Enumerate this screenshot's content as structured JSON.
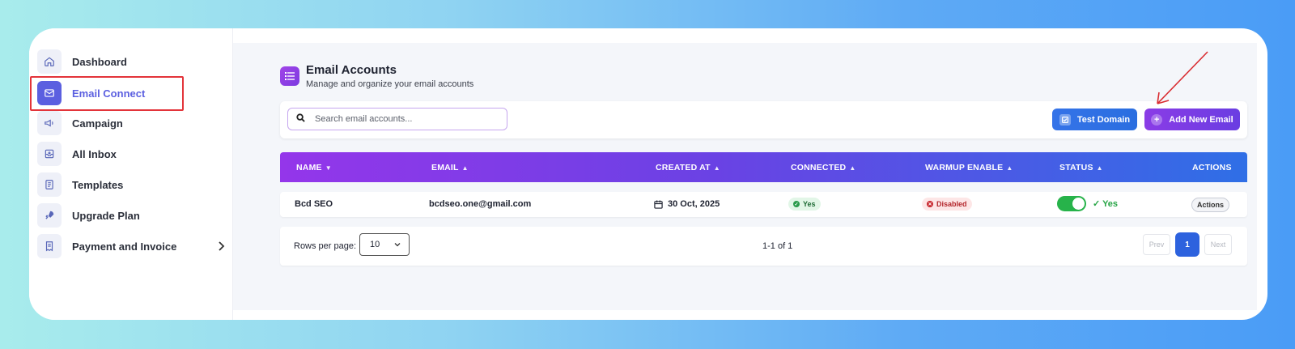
{
  "sidebar": {
    "items": [
      {
        "label": "Dashboard",
        "icon": "home-icon"
      },
      {
        "label": "Email Connect",
        "icon": "mail-icon",
        "active": true
      },
      {
        "label": "Campaign",
        "icon": "megaphone-icon"
      },
      {
        "label": "All Inbox",
        "icon": "inbox-icon"
      },
      {
        "label": "Templates",
        "icon": "document-icon"
      },
      {
        "label": "Upgrade Plan",
        "icon": "rocket-icon"
      },
      {
        "label": "Payment and Invoice",
        "icon": "receipt-icon"
      }
    ]
  },
  "header": {
    "title": "Email Accounts",
    "subtitle": "Manage and organize your email accounts"
  },
  "toolbar": {
    "search_placeholder": "Search email accounts...",
    "test_domain_label": "Test Domain",
    "add_email_label": "Add New Email"
  },
  "table": {
    "columns": [
      "NAME",
      "EMAIL",
      "CREATED AT",
      "CONNECTED",
      "WARMUP ENABLE",
      "STATUS",
      "ACTIONS"
    ],
    "rows": [
      {
        "name": "Bcd SEO",
        "email": "bcdseo.one@gmail.com",
        "created_at": "30 Oct, 2025",
        "connected": "Yes",
        "warmup": "Disabled",
        "status": "Yes",
        "status_on": true,
        "actions_label": "Actions"
      }
    ]
  },
  "pagination": {
    "rows_label": "Rows per page:",
    "rows_value": "10",
    "range": "1-1 of 1",
    "prev": "Prev",
    "current": "1",
    "next": "Next"
  },
  "colors": {
    "accent": "#5b5fe0",
    "header_gradient_start": "#9436ea",
    "header_gradient_end": "#2f6fe6",
    "success": "#27b34a",
    "danger": "#c8292f",
    "annotation": "#e3343a"
  }
}
